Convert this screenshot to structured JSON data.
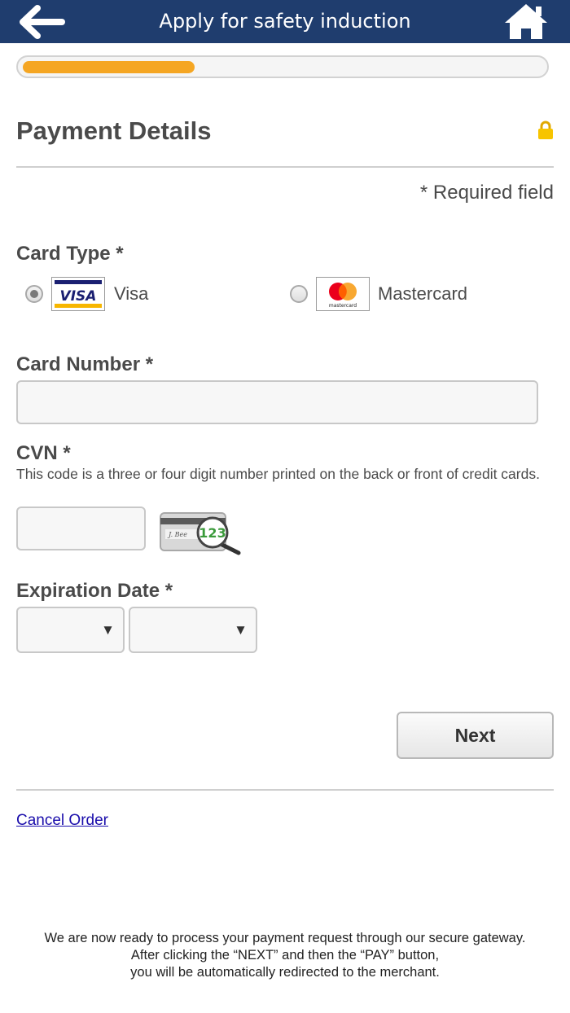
{
  "header": {
    "title": "Apply for safety induction"
  },
  "progress": {
    "fraction": 0.33
  },
  "form": {
    "section_title": "Payment Details",
    "required_note": "* Required field",
    "card_type": {
      "label": "Card Type *",
      "options": [
        {
          "label": "Visa",
          "selected": true
        },
        {
          "label": "Mastercard",
          "selected": false
        }
      ]
    },
    "card_number": {
      "label": "Card Number *",
      "value": ""
    },
    "cvn": {
      "label": "CVN *",
      "hint": "This code is a three or four digit number printed on the back or front of credit cards.",
      "value": "",
      "image_text": "123"
    },
    "expiration": {
      "label": "Expiration Date *",
      "month": "",
      "year": ""
    },
    "next_label": "Next",
    "cancel_label": "Cancel Order"
  },
  "footer": {
    "line1": "We are now ready to process your payment request through our secure gateway.",
    "line2": "After clicking the “NEXT” and then the “PAY” button,",
    "line3": "you will be automatically redirected to the merchant."
  },
  "colors": {
    "header_bg": "#1f3d6e",
    "progress_fill": "#f5a623",
    "link": "#1a0dab"
  }
}
